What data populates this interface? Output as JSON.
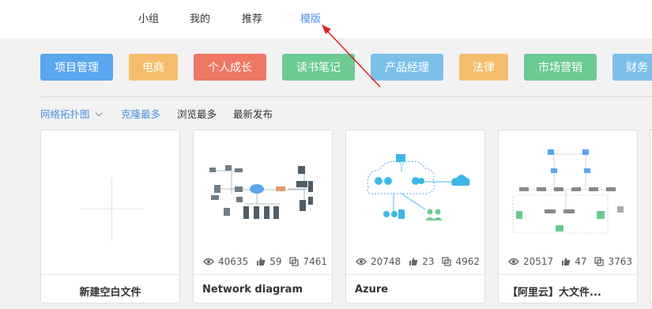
{
  "nav": {
    "items": [
      {
        "label": "小组"
      },
      {
        "label": "我的"
      },
      {
        "label": "推荐"
      },
      {
        "label": "模版",
        "active": true
      }
    ]
  },
  "categories": [
    {
      "label": "项目管理",
      "color": "#5aa6ef"
    },
    {
      "label": "电商",
      "color": "#f4bd6c"
    },
    {
      "label": "个人成长",
      "color": "#ef7766"
    },
    {
      "label": "读书笔记",
      "color": "#6cca93"
    },
    {
      "label": "产品经理",
      "color": "#7cc0ea"
    },
    {
      "label": "法律",
      "color": "#f4bd6c"
    },
    {
      "label": "市场营销",
      "color": "#6cca93"
    },
    {
      "label": "财务",
      "color": "#7cc0ea"
    }
  ],
  "sort": {
    "dropdown": "网络拓扑图",
    "options": [
      {
        "label": "克隆最多",
        "active": true
      },
      {
        "label": "浏览最多"
      },
      {
        "label": "最新发布"
      }
    ]
  },
  "cards": [
    {
      "title": "新建空白文件",
      "blank": true
    },
    {
      "title": "Network diagram",
      "views": "40635",
      "likes": "59",
      "clones": "7461"
    },
    {
      "title": "Azure",
      "views": "20748",
      "likes": "23",
      "clones": "4962"
    },
    {
      "title": "【阿里云】大文件...",
      "views": "20517",
      "likes": "47",
      "clones": "3763"
    }
  ],
  "colors": {
    "accent": "#4a90e2",
    "annotation_arrow": "#e02020"
  }
}
